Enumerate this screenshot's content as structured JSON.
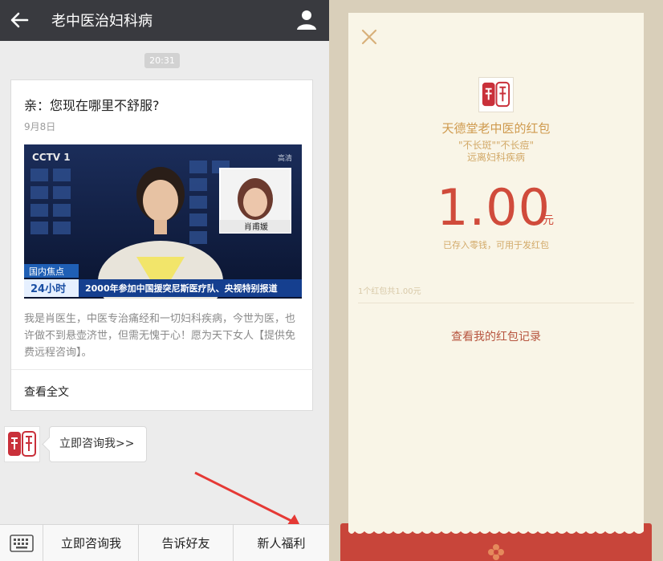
{
  "chat": {
    "title": "老中医治妇科病",
    "timestamp": "20:31",
    "article": {
      "title": "亲：您现在哪里不舒服?",
      "date": "9月8日",
      "image_text": {
        "channel": "CCTV 1",
        "channel_sub": "综合",
        "inset_name": "肖甫媛",
        "lower_tag1": "国内焦点",
        "lower_tag2": "24小时",
        "ticker": "2000年参加中国援突尼斯医疗队、央视特别报道",
        "corner_tag": "高清"
      },
      "description": "我是肖医生，中医专治痛经和一切妇科疾病，今世为医，也许做不到悬壶济世，但需无愧于心！愿为天下女人【提供免费远程咨询】。",
      "read_more": "查看全文"
    },
    "reply_bubble": "立即咨询我>>",
    "menu": [
      "立即咨询我",
      "告诉好友",
      "新人福利"
    ]
  },
  "redpacket": {
    "sender": "天德堂老中医的红包",
    "slogan1": "\"不长斑\"\"不长痘\"",
    "slogan2": "远离妇科疾病",
    "amount": "1.00",
    "unit": "元",
    "note": "已存入零钱，可用于发红包",
    "count_text": "1个红包共1.00元",
    "records_link": "查看我的红包记录"
  },
  "colors": {
    "topbar": "#393a3f",
    "amount_red": "#d04b3b",
    "gold_text": "#cf9a4e",
    "band_red": "#c8453a"
  }
}
